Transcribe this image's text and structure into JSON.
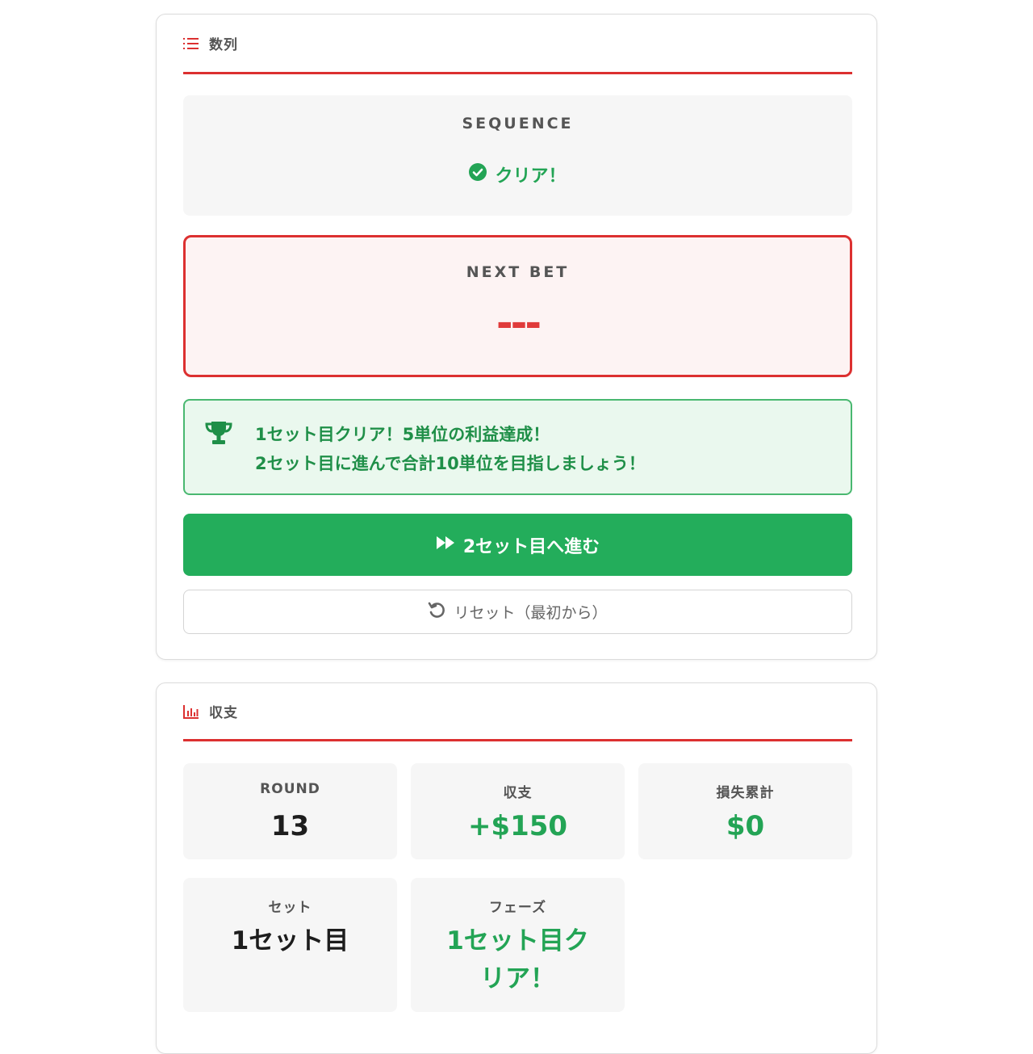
{
  "sequence_section": {
    "title": "数列",
    "sequence_label": "SEQUENCE",
    "sequence_status": "クリア！",
    "next_bet_label": "NEXT BET",
    "next_bet_value": "---",
    "message_line1": "1セット目クリア！5単位の利益達成！",
    "message_line2": "2セット目に進んで合計10単位を目指しましょう！",
    "next_set_button": "2セット目へ進む",
    "reset_button": "リセット（最初から）"
  },
  "balance_section": {
    "title": "収支",
    "stats": [
      {
        "label": "ROUND",
        "value": "13"
      },
      {
        "label": "収支",
        "value": "+$150"
      },
      {
        "label": "損失累計",
        "value": "$0"
      },
      {
        "label": "セット",
        "value": "1セット目"
      },
      {
        "label": "フェーズ",
        "value": "1セット目クリア！"
      }
    ]
  },
  "colors": {
    "accent_red": "#dc3030",
    "success_green": "#23ad5b",
    "message_green": "#1f8f48"
  }
}
